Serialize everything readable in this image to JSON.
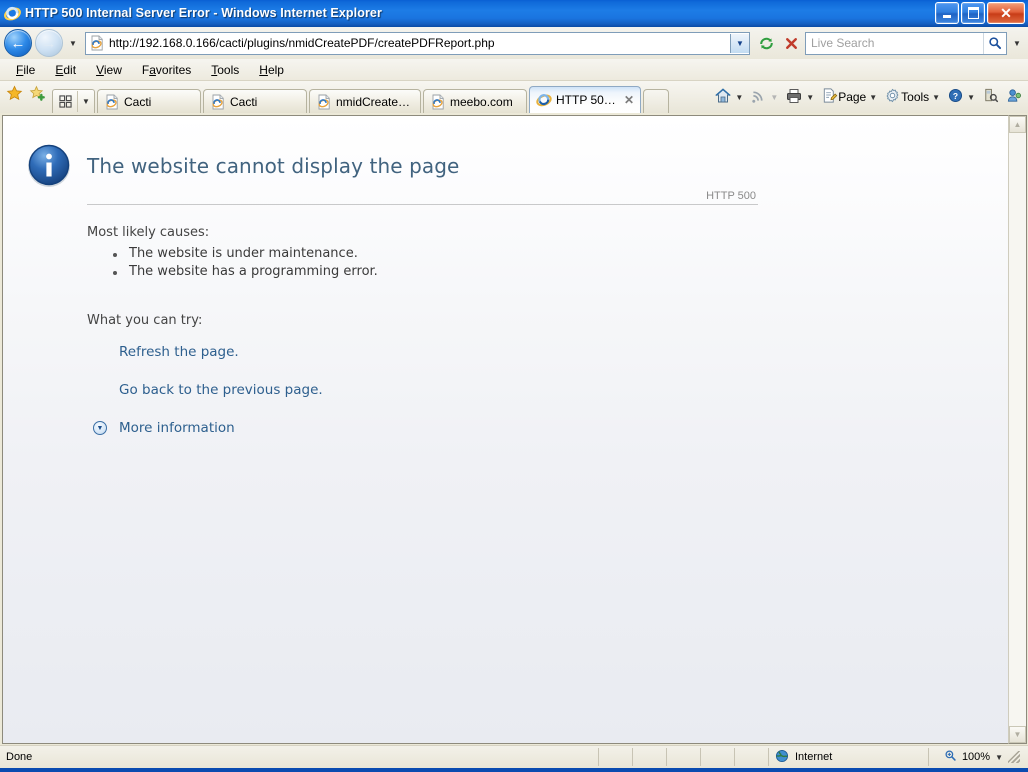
{
  "window": {
    "title": "HTTP 500 Internal Server Error - Windows Internet Explorer",
    "app_icon": "ie-logo-icon",
    "minimize_label": "",
    "restore_label": "",
    "close_label": "✕"
  },
  "navbar": {
    "back_glyph": "←",
    "forward_glyph": "→",
    "history_caret": "▼",
    "address_value": "http://192.168.0.166/cacti/plugins/nmidCreatePDF/createPDFReport.php",
    "address_caret": "▼",
    "refresh_icon": "refresh-icon",
    "stop_icon": "stop-icon",
    "search_placeholder": "Live Search",
    "search_icon": "magnifier-icon",
    "search_caret": "▼"
  },
  "menubar": {
    "items": [
      {
        "pre": "",
        "key": "F",
        "post": "ile"
      },
      {
        "pre": "",
        "key": "E",
        "post": "dit"
      },
      {
        "pre": "",
        "key": "V",
        "post": "iew"
      },
      {
        "pre": "F",
        "key": "a",
        "post": "vorites"
      },
      {
        "pre": "",
        "key": "T",
        "post": "ools"
      },
      {
        "pre": "",
        "key": "H",
        "post": "elp"
      }
    ]
  },
  "tabbar": {
    "favorites_icon": "star-icon",
    "add_favorite_icon": "star-plus-icon",
    "quicktabs_icon": "quick-tabs-grid-icon",
    "quicktabs_caret": "▼",
    "tabs": [
      {
        "label": "Cacti",
        "active": false,
        "icon": "page-icon"
      },
      {
        "label": "Cacti",
        "active": false,
        "icon": "page-icon"
      },
      {
        "label": "nmidCreatePD...",
        "active": false,
        "icon": "page-icon"
      },
      {
        "label": "meebo.com",
        "active": false,
        "icon": "page-icon"
      },
      {
        "label": "HTTP 500 I...",
        "active": true,
        "icon": "ie-logo-icon",
        "close": "✕"
      }
    ]
  },
  "commandbar": {
    "items": [
      {
        "name": "home",
        "label": "",
        "icon": "home-icon",
        "caret": "▼",
        "dim": false
      },
      {
        "name": "feeds",
        "label": "",
        "icon": "rss-icon",
        "caret": "▼",
        "dim": true
      },
      {
        "name": "print",
        "label": "",
        "icon": "printer-icon",
        "caret": "▼",
        "dim": false
      },
      {
        "name": "page",
        "label": "Page",
        "icon": "page-edit-icon",
        "caret": "▼",
        "dim": false
      },
      {
        "name": "tools",
        "label": "Tools",
        "icon": "gear-icon",
        "caret": "▼",
        "dim": false
      },
      {
        "name": "help",
        "label": "",
        "icon": "help-icon",
        "caret": "▼",
        "dim": false
      },
      {
        "name": "research",
        "label": "",
        "icon": "research-icon",
        "caret": "",
        "dim": false
      },
      {
        "name": "messenger",
        "label": "",
        "icon": "messenger-icon",
        "caret": "",
        "dim": false
      }
    ]
  },
  "error_page": {
    "icon": "info-icon",
    "title": "The website cannot display the page",
    "http_code": "HTTP 500",
    "causes_label": "Most likely causes:",
    "causes": [
      "The website is under maintenance.",
      "The website has a programming error."
    ],
    "try_label": "What you can try:",
    "actions": [
      {
        "label": "Refresh the page.",
        "bullet": "dot"
      },
      {
        "label": "Go back to the previous page.",
        "bullet": "dot"
      },
      {
        "label": "More information",
        "bullet": "chevron"
      }
    ]
  },
  "scrollbar": {
    "up_glyph": "▲",
    "down_glyph": "▼"
  },
  "statusbar": {
    "status": "Done",
    "zone_icon": "globe-icon",
    "zone": "Internet",
    "zoom_icon": "zoom-icon",
    "zoom": "100%",
    "zoom_caret": "▼"
  },
  "colors": {
    "titlebar_blue": "#1d7ce6",
    "link_blue": "#2d5f8e",
    "heading_blue": "#41637f",
    "chrome_beige": "#ece9d8"
  }
}
